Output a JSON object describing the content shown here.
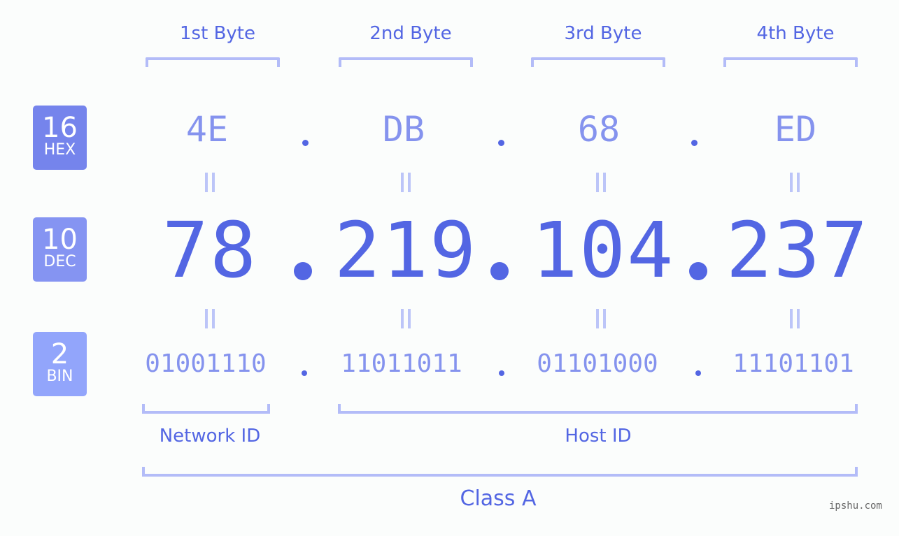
{
  "bytes": {
    "headers": [
      "1st Byte",
      "2nd Byte",
      "3rd Byte",
      "4th Byte"
    ]
  },
  "rows": {
    "hex": {
      "badge_number": "16",
      "badge_label": "HEX",
      "badge_color": "#7584ec",
      "values": [
        "4E",
        "DB",
        "68",
        "ED"
      ]
    },
    "dec": {
      "badge_number": "10",
      "badge_label": "DEC",
      "badge_color": "#8594f2",
      "values": [
        "78",
        "219",
        "104",
        "237"
      ]
    },
    "bin": {
      "badge_number": "2",
      "badge_label": "BIN",
      "badge_color": "#92a5fb",
      "values": [
        "01001110",
        "11011011",
        "01101000",
        "11101101"
      ]
    }
  },
  "sections": {
    "network_id": "Network ID",
    "host_id": "Host ID",
    "class": "Class A"
  },
  "colors": {
    "accent": "#5366e3",
    "light_value": "#8593ee",
    "bracket": "#b3bcf8"
  },
  "watermark": "ipshu.com"
}
